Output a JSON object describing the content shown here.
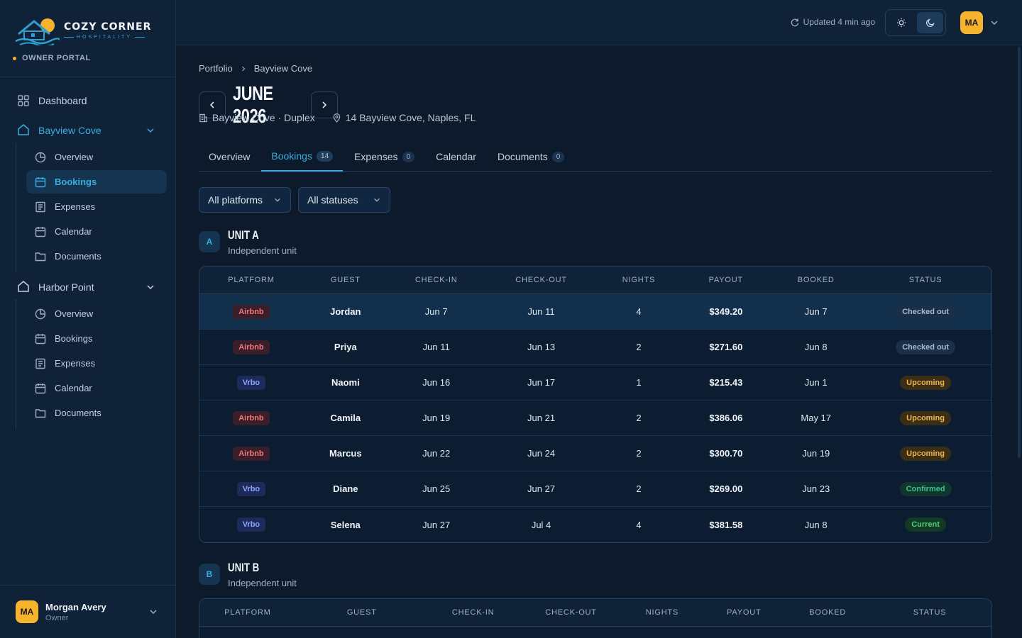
{
  "brand": {
    "name": "COZY CORNER",
    "sub": "HOSPITALITY",
    "portal": "OWNER PORTAL"
  },
  "nav": {
    "dashboard": "Dashboard",
    "groups": [
      {
        "label": "Bayview Cove",
        "items": [
          "Overview",
          "Bookings",
          "Expenses",
          "Calendar",
          "Documents"
        ]
      },
      {
        "label": "Harbor Point",
        "items": [
          "Overview",
          "Bookings",
          "Expenses",
          "Calendar",
          "Documents"
        ]
      }
    ]
  },
  "user": {
    "initials": "MA",
    "name": "Morgan Avery",
    "role": "Owner"
  },
  "topbar": {
    "updated": "Updated 4 min ago"
  },
  "breadcrumb": [
    "Portfolio",
    "Bayview Cove"
  ],
  "month": "JUNE 2026",
  "property": {
    "name": "Bayview Cove · Duplex",
    "address": "14 Bayview Cove, Naples, FL"
  },
  "tabs": [
    {
      "label": "Overview",
      "count": ""
    },
    {
      "label": "Bookings",
      "count": "14"
    },
    {
      "label": "Expenses",
      "count": "0"
    },
    {
      "label": "Calendar",
      "count": ""
    },
    {
      "label": "Documents",
      "count": "0"
    }
  ],
  "filters": {
    "platform": "All platforms",
    "status": "All statuses"
  },
  "columns": [
    "PLATFORM",
    "GUEST",
    "CHECK-IN",
    "CHECK-OUT",
    "NIGHTS",
    "PAYOUT",
    "BOOKED",
    "STATUS"
  ],
  "unitA": {
    "badge": "A",
    "title": "UNIT A",
    "sub": "Independent unit",
    "rows": [
      {
        "platform": "Airbnb",
        "guest": "Jordan",
        "checkin": "Jun 7",
        "checkout": "Jun 11",
        "nights": "4",
        "payout": "$349.20",
        "booked": "Jun 7",
        "status": "Checked out",
        "st": "out"
      },
      {
        "platform": "Airbnb",
        "guest": "Priya",
        "checkin": "Jun 11",
        "checkout": "Jun 13",
        "nights": "2",
        "payout": "$271.60",
        "booked": "Jun 8",
        "status": "Checked out",
        "st": "out"
      },
      {
        "platform": "Vrbo",
        "guest": "Naomi",
        "checkin": "Jun 16",
        "checkout": "Jun 17",
        "nights": "1",
        "payout": "$215.43",
        "booked": "Jun 1",
        "status": "Upcoming",
        "st": "up"
      },
      {
        "platform": "Airbnb",
        "guest": "Camila",
        "checkin": "Jun 19",
        "checkout": "Jun 21",
        "nights": "2",
        "payout": "$386.06",
        "booked": "May 17",
        "status": "Upcoming",
        "st": "up"
      },
      {
        "platform": "Airbnb",
        "guest": "Marcus",
        "checkin": "Jun 22",
        "checkout": "Jun 24",
        "nights": "2",
        "payout": "$300.70",
        "booked": "Jun 19",
        "status": "Upcoming",
        "st": "up"
      },
      {
        "platform": "Vrbo",
        "guest": "Diane",
        "checkin": "Jun 25",
        "checkout": "Jun 27",
        "nights": "2",
        "payout": "$269.00",
        "booked": "Jun 23",
        "status": "Confirmed",
        "st": "conf"
      },
      {
        "platform": "Vrbo",
        "guest": "Selena",
        "checkin": "Jun 27",
        "checkout": "Jul 4",
        "nights": "4",
        "payout": "$381.58",
        "booked": "Jun 8",
        "status": "Current",
        "st": "cur"
      }
    ]
  },
  "unitB": {
    "badge": "B",
    "title": "UNIT B",
    "sub": "Independent unit"
  }
}
